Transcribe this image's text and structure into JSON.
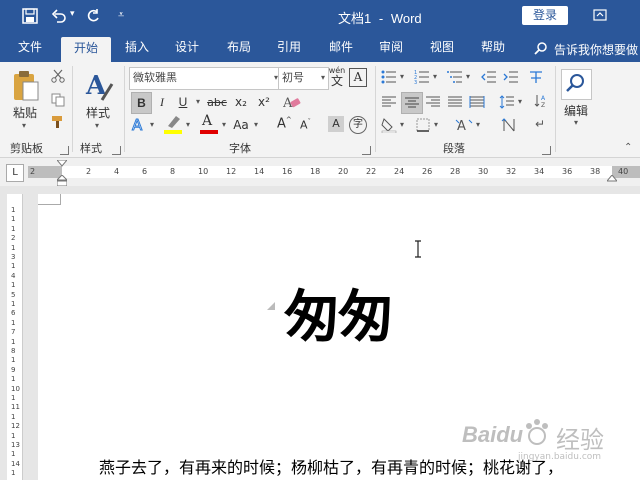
{
  "titlebar": {
    "doc_title": "文档1",
    "separator": "-",
    "app_name": "Word",
    "login": "登录"
  },
  "tabs": [
    {
      "label": "文件"
    },
    {
      "label": "开始"
    },
    {
      "label": "插入"
    },
    {
      "label": "设计"
    },
    {
      "label": "布局"
    },
    {
      "label": "引用"
    },
    {
      "label": "邮件"
    },
    {
      "label": "审阅"
    },
    {
      "label": "视图"
    },
    {
      "label": "帮助"
    }
  ],
  "tell_me": "告诉我你想要做",
  "ribbon": {
    "clipboard": {
      "paste": "粘贴",
      "label": "剪贴板"
    },
    "styles": {
      "btn": "样式",
      "label": "样式"
    },
    "font": {
      "family": "微软雅黑",
      "size": "初号",
      "pinyin": "wén",
      "bold": "B",
      "italic": "I",
      "underline": "U",
      "strike": "abc",
      "sub": "x₂",
      "sup": "x²",
      "aa_case": "Aa",
      "label": "字体",
      "enclose": "字"
    },
    "paragraph": {
      "label": "段落"
    },
    "editing": {
      "btn": "编辑"
    }
  },
  "ruler": {
    "corner": "L",
    "ticks": [
      "2",
      "2",
      "4",
      "6",
      "8",
      "10",
      "12",
      "14",
      "16",
      "18",
      "20",
      "22",
      "24",
      "26",
      "28",
      "30",
      "32",
      "34",
      "36",
      "38",
      "40"
    ],
    "vticks": [
      "1",
      "1",
      "1",
      "2",
      "1",
      "3",
      "1",
      "4",
      "1",
      "5",
      "1",
      "6",
      "1",
      "7",
      "1",
      "8",
      "1",
      "9",
      "1",
      "10",
      "1",
      "11",
      "1",
      "12",
      "1",
      "13",
      "1",
      "14",
      "1",
      "15"
    ]
  },
  "document": {
    "title": "匆匆",
    "body": "燕子去了，有再来的时候；杨柳枯了，有再青的时候；桃花谢了，"
  },
  "watermark": {
    "logo": "Baidu",
    "suffix": "经验",
    "url": "jingyan.baidu.com"
  },
  "colors": {
    "accent": "#2b579a",
    "highlight": "#ffff00",
    "font_color": "#e00000"
  }
}
